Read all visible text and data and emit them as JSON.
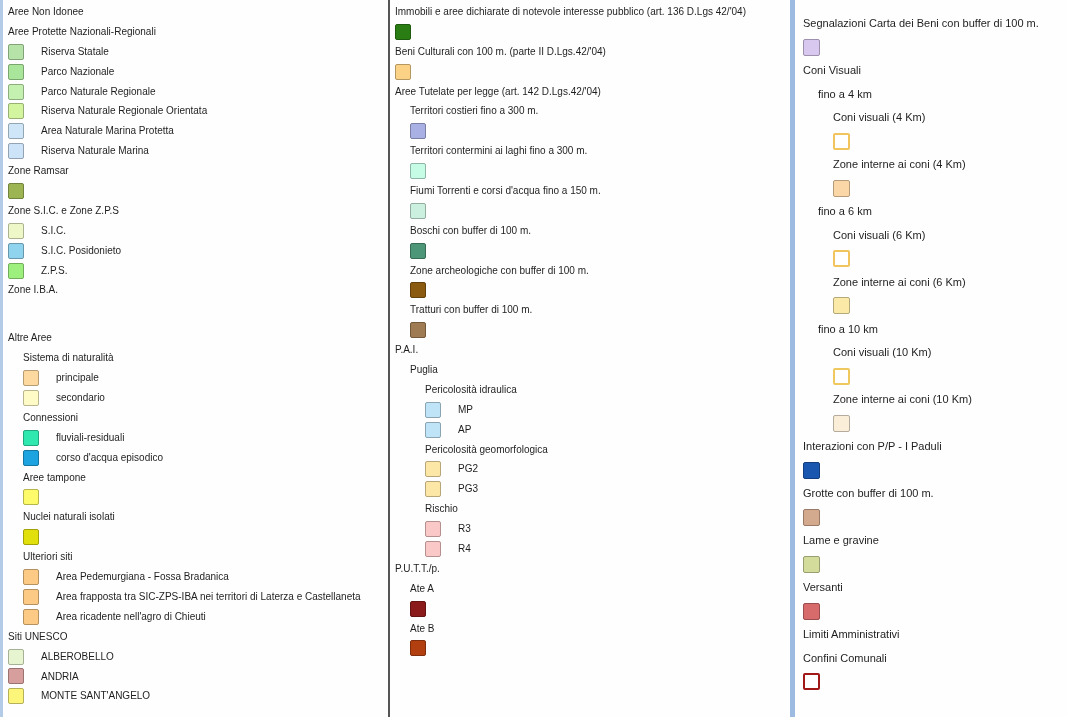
{
  "columns": [
    {
      "entries": [
        {
          "kind": "heading",
          "label": "Aree Non Idonee"
        },
        {
          "kind": "group",
          "label": "Aree Protette Nazionali-Regionali",
          "children": [
            {
              "kind": "item",
              "label": "Riserva Statale",
              "color": "#b5e3a8"
            },
            {
              "kind": "item",
              "label": "Parco Nazionale",
              "color": "#a9e59a"
            },
            {
              "kind": "item",
              "label": "Parco Naturale Regionale",
              "color": "#c4f0b0"
            },
            {
              "kind": "item",
              "label": "Riserva Naturale Regionale Orientata",
              "color": "#d4f5a0"
            },
            {
              "kind": "item",
              "label": "Area Naturale Marina Protetta",
              "color": "#cfe6f8"
            },
            {
              "kind": "item",
              "label": "Riserva Naturale Marina",
              "color": "#cde3f7"
            }
          ]
        },
        {
          "kind": "single",
          "label": "Zone Ramsar",
          "color": "#9cb552"
        },
        {
          "kind": "group",
          "label": "Zone S.I.C. e Zone Z.P.S",
          "children": [
            {
              "kind": "item",
              "label": "S.I.C.",
              "color": "#edf7c8"
            },
            {
              "kind": "item",
              "label": "S.I.C. Posidonieto",
              "color": "#8fd3ef"
            },
            {
              "kind": "item",
              "label": "Z.P.S.",
              "color": "#9ef07e"
            }
          ]
        },
        {
          "kind": "group",
          "label": "Zone I.B.A."
        },
        {
          "kind": "group",
          "label": "Altre Aree",
          "children": [
            {
              "kind": "group",
              "label": "Sistema di naturalità",
              "children": [
                {
                  "kind": "item",
                  "label": "principale",
                  "color": "#fdd9a0"
                },
                {
                  "kind": "item",
                  "label": "secondario",
                  "color": "#fffbc6"
                }
              ]
            },
            {
              "kind": "group",
              "label": "Connessioni",
              "children": [
                {
                  "kind": "item",
                  "label": "fluviali-residuali",
                  "color": "#2ee8b0"
                },
                {
                  "kind": "item",
                  "label": "corso d'acqua episodico",
                  "color": "#1ca3e0"
                }
              ]
            },
            {
              "kind": "single",
              "label": "Aree tampone",
              "color": "#fdfb6a"
            },
            {
              "kind": "single",
              "label": "Nuclei naturali isolati",
              "color": "#e2e00c"
            },
            {
              "kind": "group",
              "label": "Ulteriori siti",
              "children": [
                {
                  "kind": "item",
                  "label": "Area Pedemurgiana - Fossa Bradanica",
                  "color": "#fdca85"
                },
                {
                  "kind": "item",
                  "label": "Area frapposta tra SIC-ZPS-IBA nei territori di Laterza e Castellaneta",
                  "color": "#fdca85"
                },
                {
                  "kind": "item",
                  "label": "Area ricadente nell'agro di Chieuti",
                  "color": "#fdca85"
                }
              ]
            }
          ]
        },
        {
          "kind": "group",
          "label": "Siti UNESCO",
          "children": [
            {
              "kind": "item",
              "label": "ALBEROBELLO",
              "color": "#e6f5cf"
            },
            {
              "kind": "item",
              "label": "ANDRIA",
              "color": "#d79e9e"
            },
            {
              "kind": "item",
              "label": "MONTE SANT'ANGELO",
              "color": "#fdf57a"
            }
          ]
        }
      ]
    },
    {
      "entries": [
        {
          "kind": "single",
          "label": "Immobili e aree dichiarate di notevole interesse pubblico (art. 136 D.Lgs 42/'04)",
          "color": "#2a7d12"
        },
        {
          "kind": "single",
          "label": "Beni Culturali con 100 m. (parte II D.Lgs.42/'04)",
          "color": "#fcd286"
        },
        {
          "kind": "group",
          "label": "Aree Tutelate per legge (art. 142 D.Lgs.42/'04)",
          "children": [
            {
              "kind": "single",
              "label": "Territori costieri fino a 300 m.",
              "color": "#a9b0e3"
            },
            {
              "kind": "single",
              "label": "Territori contermini ai laghi fino a 300 m.",
              "color": "#c6fbe6"
            },
            {
              "kind": "single",
              "label": "Fiumi Torrenti e corsi d'acqua fino a 150 m.",
              "color": "#ccf0e0"
            },
            {
              "kind": "single",
              "label": "Boschi con buffer di 100 m.",
              "color": "#4e9678"
            },
            {
              "kind": "single",
              "label": "Zone archeologiche con buffer di 100 m.",
              "color": "#8a5a10"
            },
            {
              "kind": "single",
              "label": "Tratturi con buffer di 100 m.",
              "color": "#9e7b52"
            }
          ]
        },
        {
          "kind": "group",
          "label": "P.A.I.",
          "children": [
            {
              "kind": "group",
              "label": "Puglia",
              "children": [
                {
                  "kind": "group",
                  "label": "Pericolosità idraulica",
                  "children": [
                    {
                      "kind": "item",
                      "label": "MP",
                      "color": "#c0e4f7"
                    },
                    {
                      "kind": "item",
                      "label": "AP",
                      "color": "#c0e4f7"
                    }
                  ]
                },
                {
                  "kind": "group",
                  "label": "Pericolosità geomorfologica",
                  "children": [
                    {
                      "kind": "item",
                      "label": "PG2",
                      "color": "#fde7a6"
                    },
                    {
                      "kind": "item",
                      "label": "PG3",
                      "color": "#fde7a6"
                    }
                  ]
                },
                {
                  "kind": "group",
                  "label": "Rischio",
                  "children": [
                    {
                      "kind": "item",
                      "label": "R3",
                      "color": "#fbc8c8"
                    },
                    {
                      "kind": "item",
                      "label": "R4",
                      "color": "#fbc8c8"
                    }
                  ]
                }
              ]
            }
          ]
        },
        {
          "kind": "group",
          "label": "P.U.T.T./p.",
          "children": [
            {
              "kind": "single",
              "label": "Ate A",
              "color": "#8b1a1a"
            },
            {
              "kind": "single",
              "label": "Ate B",
              "color": "#b13f10"
            }
          ]
        }
      ]
    },
    {
      "entries": [
        {
          "kind": "single",
          "label": "Segnalazioni Carta dei Beni con buffer di 100 m.",
          "color": "#d8c8f0"
        },
        {
          "kind": "group",
          "label": "Coni Visuali",
          "children": [
            {
              "kind": "group",
              "label": "fino a 4 km",
              "children": [
                {
                  "kind": "single",
                  "label": "Coni visuali (4 Km)",
                  "color": "#f2c45e",
                  "hollow": true
                },
                {
                  "kind": "single",
                  "label": "Zone interne ai coni (4 Km)",
                  "color": "#fbd7a8"
                }
              ]
            },
            {
              "kind": "group",
              "label": "fino a 6 km",
              "children": [
                {
                  "kind": "single",
                  "label": "Coni visuali (6 Km)",
                  "color": "#f2c45e",
                  "hollow": true
                },
                {
                  "kind": "single",
                  "label": "Zone interne ai coni (6 Km)",
                  "color": "#fbe9a8"
                }
              ]
            },
            {
              "kind": "group",
              "label": "fino a 10 km",
              "children": [
                {
                  "kind": "single",
                  "label": "Coni visuali (10 Km)",
                  "color": "#f0c860",
                  "hollow": true
                },
                {
                  "kind": "single",
                  "label": "Zone interne ai coni (10 Km)",
                  "color": "#fbeed8"
                }
              ]
            }
          ]
        },
        {
          "kind": "single",
          "label": "Interazioni con P/P - I Paduli",
          "color": "#1956b0"
        },
        {
          "kind": "single",
          "label": "Grotte con buffer di 100 m.",
          "color": "#d4aa8e"
        },
        {
          "kind": "single",
          "label": "Lame e gravine",
          "color": "#d4dc9c"
        },
        {
          "kind": "single",
          "label": "Versanti",
          "color": "#d76a6a"
        },
        {
          "kind": "heading",
          "label": "Limiti Amministrativi"
        },
        {
          "kind": "single",
          "label": "Confini Comunali",
          "color": "#a01818",
          "hollow": true
        }
      ]
    }
  ]
}
